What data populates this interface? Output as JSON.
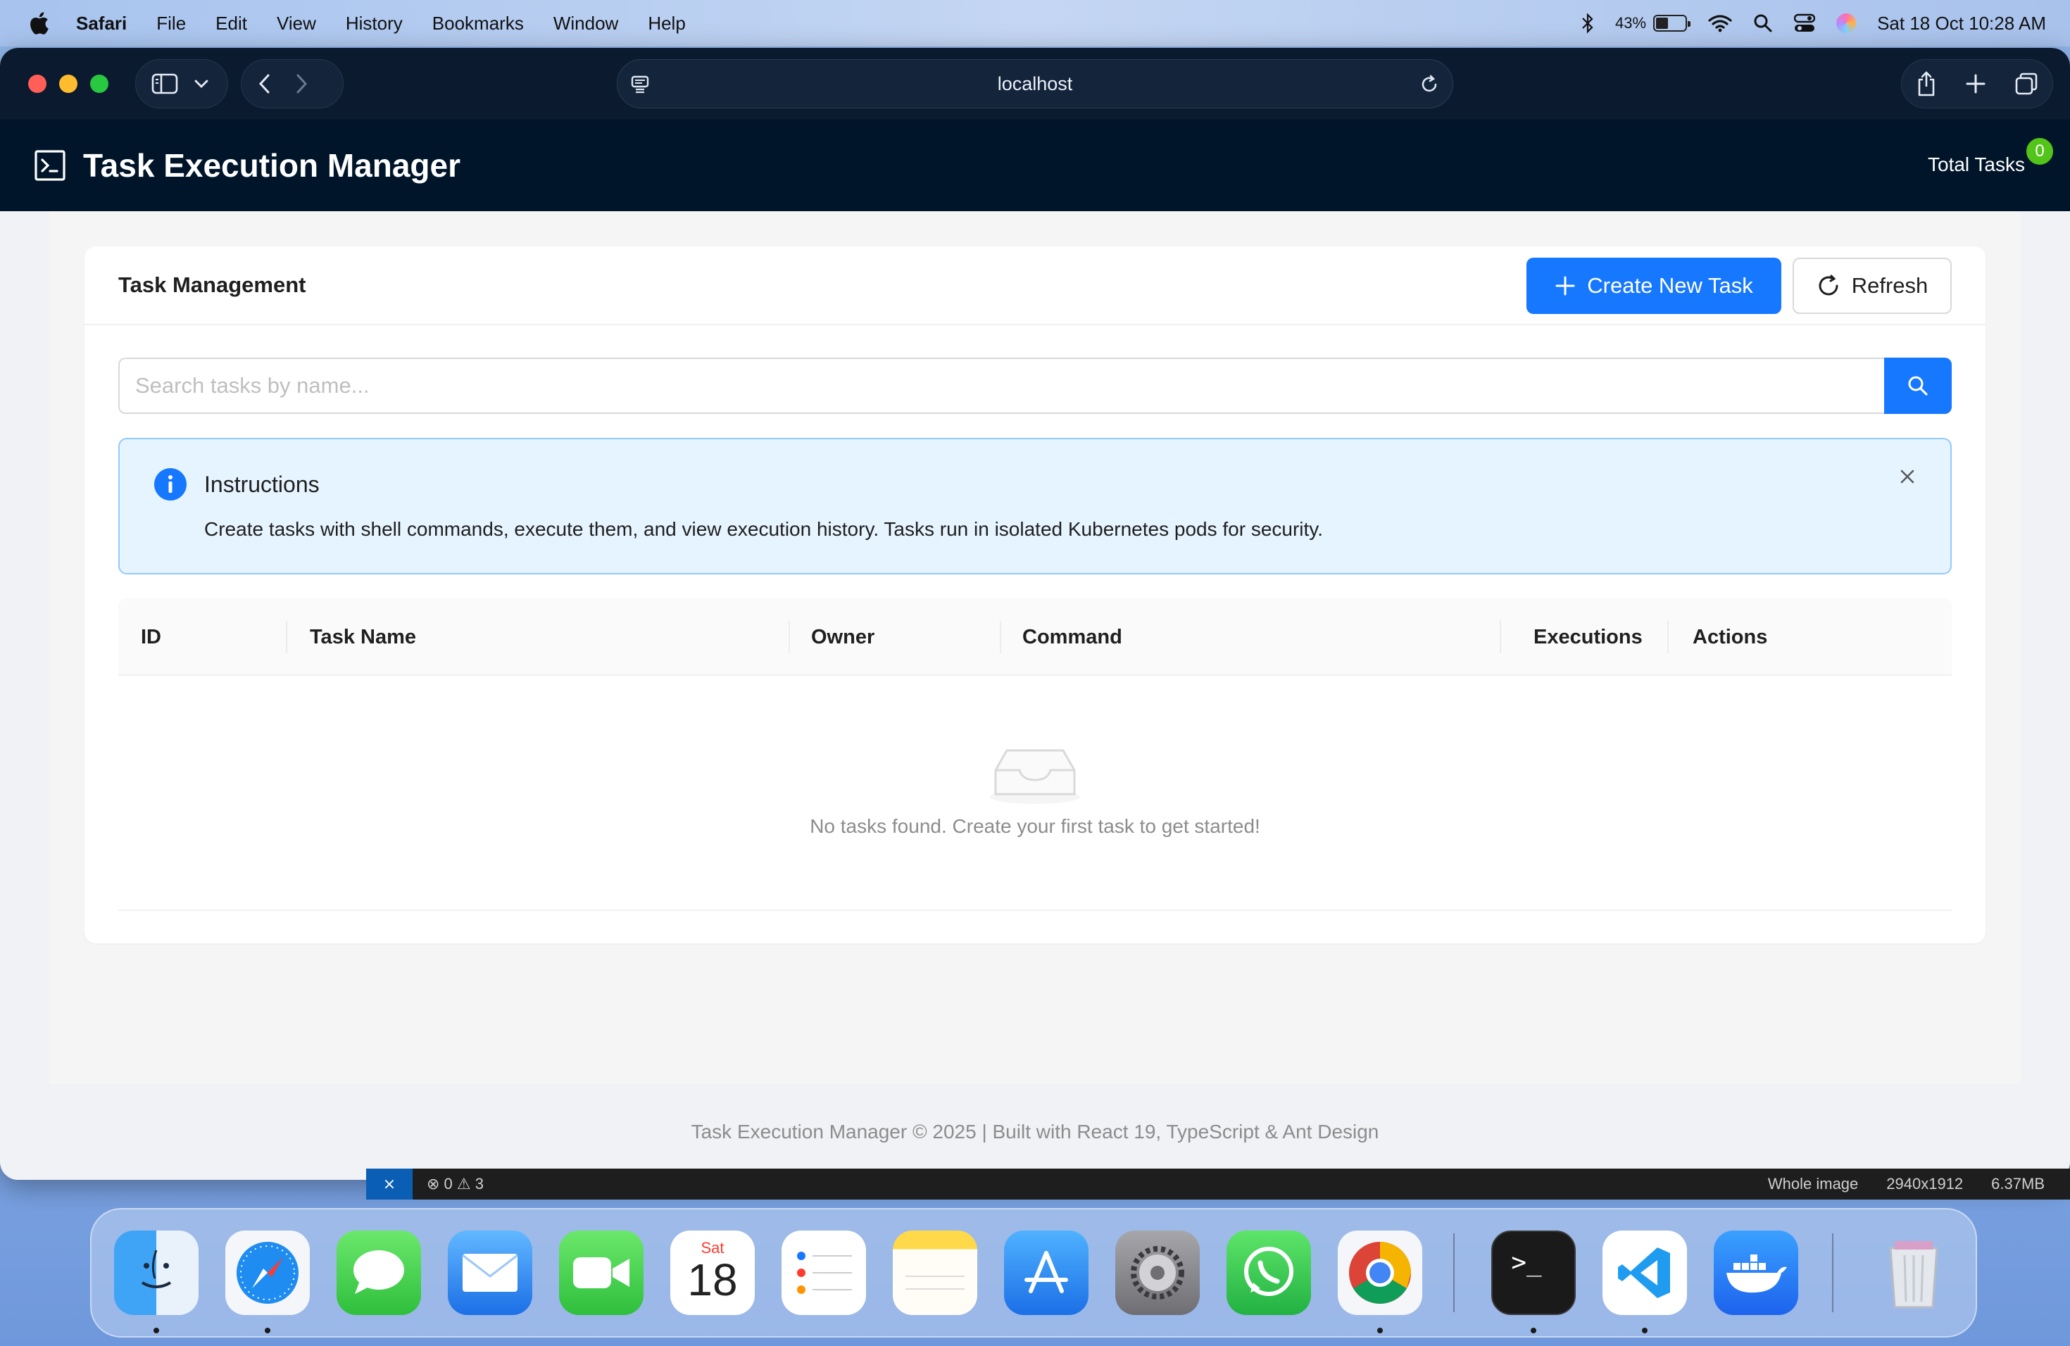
{
  "menubar": {
    "app_name": "Safari",
    "items": [
      "File",
      "Edit",
      "View",
      "History",
      "Bookmarks",
      "Window",
      "Help"
    ],
    "battery_percent": "43%",
    "battery_level": 0.43,
    "datetime": "Sat 18 Oct  10:28 AM"
  },
  "browser": {
    "url": "localhost"
  },
  "app": {
    "title": "Task Execution Manager",
    "total_tasks_label": "Total Tasks",
    "total_tasks_count": "0"
  },
  "card": {
    "title": "Task Management",
    "create_button": "Create New Task",
    "refresh_button": "Refresh"
  },
  "search": {
    "placeholder": "Search tasks by name..."
  },
  "alert": {
    "title": "Instructions",
    "description": "Create tasks with shell commands, execute them, and view execution history. Tasks run in isolated Kubernetes pods for security."
  },
  "table": {
    "columns": [
      "ID",
      "Task Name",
      "Owner",
      "Command",
      "Executions",
      "Actions"
    ],
    "empty_text": "No tasks found. Create your first task to get started!"
  },
  "footer": {
    "text": "Task Execution Manager © 2025 | Built with React 19, TypeScript & Ant Design"
  },
  "background_strip": {
    "problems": "0 ⚠ 3",
    "labels": [
      "Whole image",
      "2940x1912",
      "6.37MB"
    ]
  },
  "dock": {
    "apps": [
      "Finder",
      "Safari",
      "Messages",
      "Mail",
      "FaceTime",
      "Calendar",
      "Reminders",
      "Notes",
      "App Store",
      "System Settings",
      "WhatsApp",
      "Chrome",
      "Terminal",
      "Visual Studio Code",
      "Docker",
      "Trash"
    ],
    "calendar_day": "Sat",
    "calendar_date": "18",
    "terminal_prompt": ">_"
  },
  "colors": {
    "primary": "#1677ff",
    "header_bg": "#001529",
    "toolbar_bg": "#0b1a2e",
    "badge_green": "#52c41a",
    "alert_bg": "#e6f4ff",
    "alert_border": "#91caff"
  }
}
